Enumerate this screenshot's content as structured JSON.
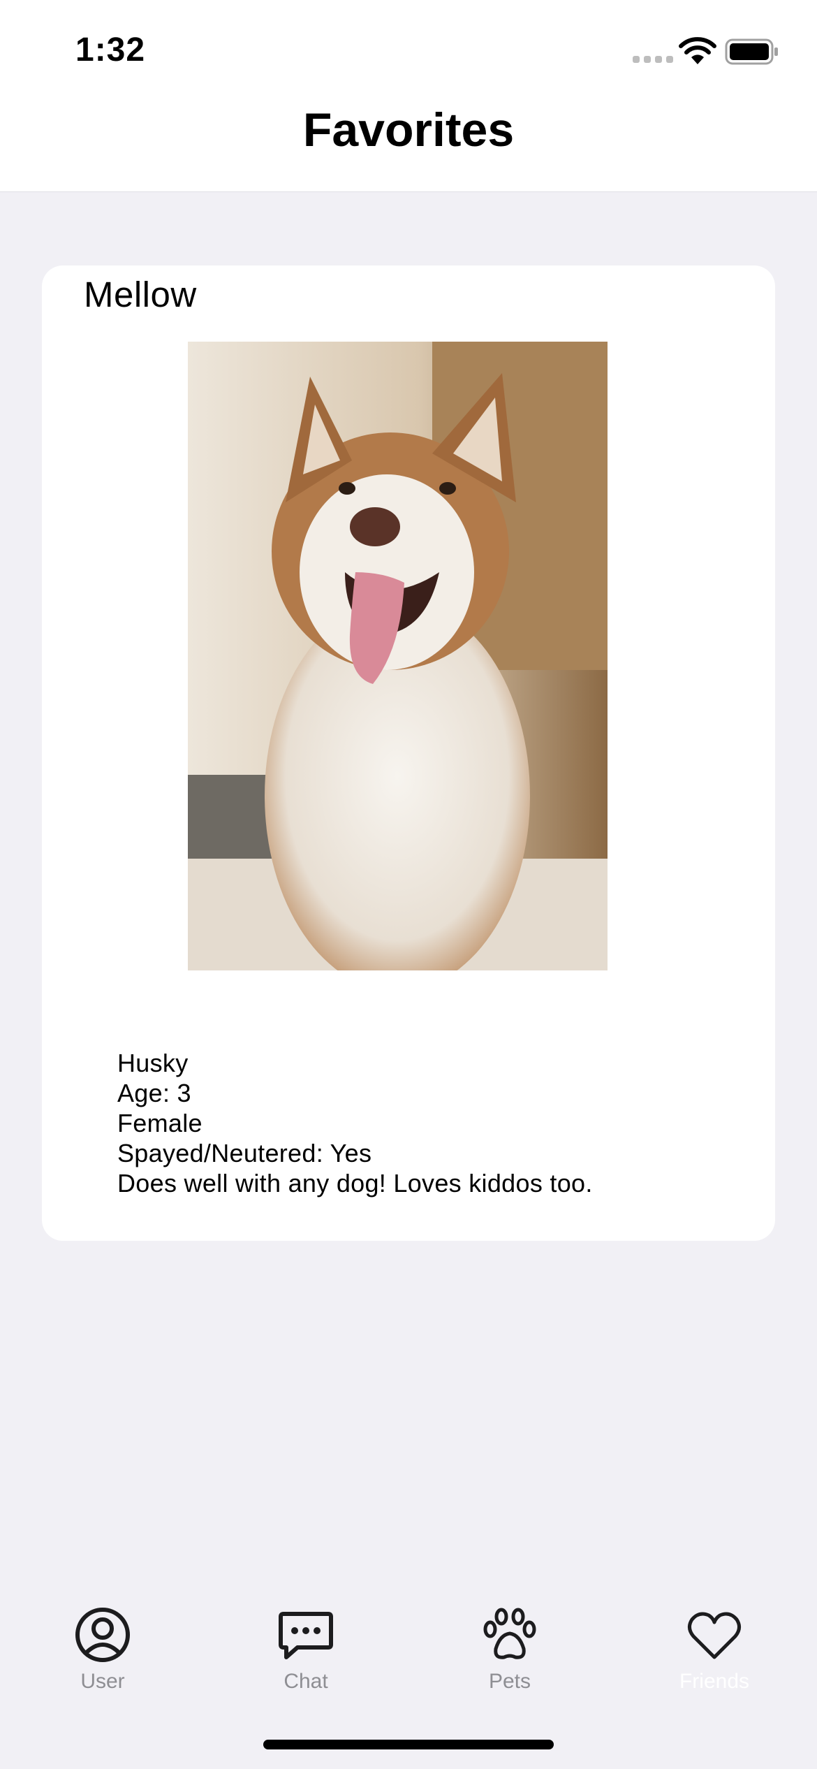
{
  "status_bar": {
    "time": "1:32",
    "icons": [
      "signal-icon",
      "wifi-icon",
      "battery-icon"
    ]
  },
  "nav": {
    "title": "Favorites"
  },
  "pet": {
    "name": "Mellow",
    "photo_description_icon": "husky-photo",
    "details": [
      "Husky",
      "Age: 3",
      "Female",
      "Spayed/Neutered: Yes",
      "Does well with any dog! Loves kiddos too."
    ]
  },
  "tabs": [
    {
      "label": "User",
      "icon": "user-circle-icon",
      "active": false
    },
    {
      "label": "Chat",
      "icon": "chat-bubble-icon",
      "active": false
    },
    {
      "label": "Pets",
      "icon": "paw-icon",
      "active": false
    },
    {
      "label": "Friends",
      "icon": "heart-icon",
      "active": true
    }
  ],
  "colors": {
    "background": "#F1F0F5",
    "card": "#FFFFFF",
    "inactive_tab": "#8E8E93",
    "active_tab_label": "#FFFFFF"
  }
}
